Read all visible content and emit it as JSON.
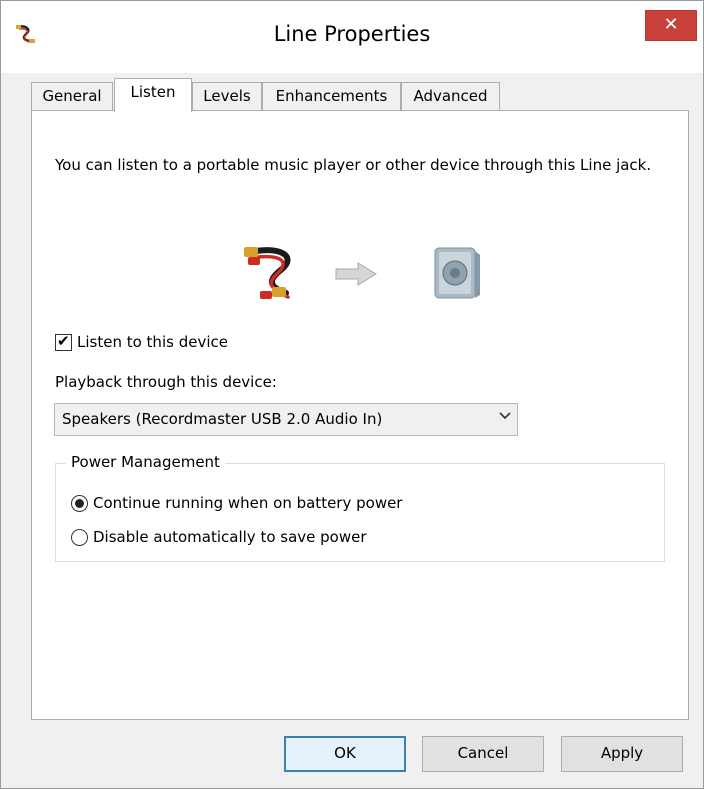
{
  "window": {
    "title": "Line Properties",
    "close_label": "✕"
  },
  "tabs": [
    {
      "label": "General"
    },
    {
      "label": "Listen"
    },
    {
      "label": "Levels"
    },
    {
      "label": "Enhancements"
    },
    {
      "label": "Advanced"
    }
  ],
  "active_tab": "Listen",
  "listen": {
    "description": "You can listen to a portable music player or other device through this Line jack.",
    "listen_checkbox_label": "Listen to this device",
    "listen_checked": true,
    "playback_label": "Playback through this device:",
    "playback_device": "Speakers (Recordmaster USB 2.0 Audio In)"
  },
  "power": {
    "group_title": "Power Management",
    "option_continue": "Continue running when on battery power",
    "option_disable": "Disable automatically to save power",
    "selected": "continue"
  },
  "buttons": {
    "ok": "OK",
    "cancel": "Cancel",
    "apply": "Apply"
  },
  "colors": {
    "close_button": "#c7403a",
    "default_button_border": "#3c7fb1"
  },
  "icons": [
    "audio-cable-icon",
    "arrow-right-icon",
    "speaker-icon",
    "chevron-down-icon",
    "close-icon"
  ]
}
